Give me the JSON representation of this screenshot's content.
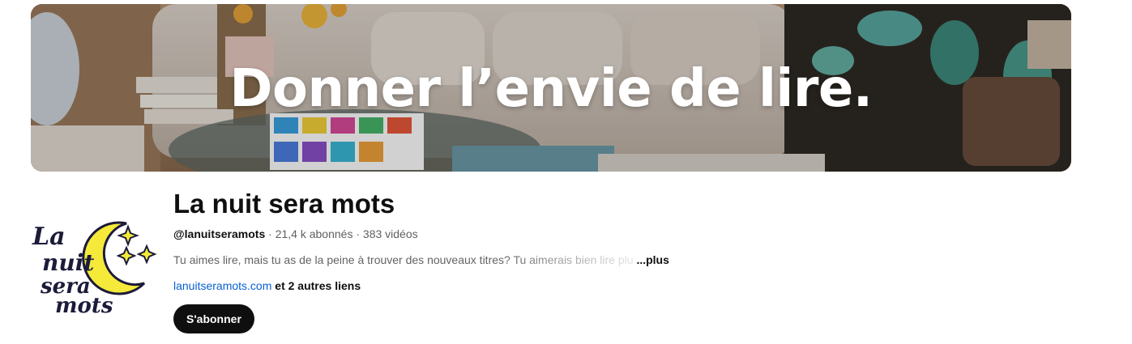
{
  "banner": {
    "headline": "Donner l’envie de lire."
  },
  "channel": {
    "name": "La nuit sera mots",
    "handle": "@lanuitseramots",
    "separator": " · ",
    "subscribers": "21,4 k abonnés",
    "videos": "383 vidéos",
    "description": "Tu aimes lire, mais tu as de la peine à trouver des nouveaux titres? Tu aimerais bien lire plu",
    "more_label": "...plus",
    "link_text": "lanuitseramots.com",
    "other_links": " et 2 autres liens",
    "subscribe_label": "S'abonner"
  },
  "avatar": {
    "logo_lines": [
      "La",
      "nuit",
      "sera",
      "mots"
    ]
  },
  "colors": {
    "subscribe_bg": "#0f0f0f",
    "link": "#065fd4",
    "moon": "#f5e93a"
  }
}
